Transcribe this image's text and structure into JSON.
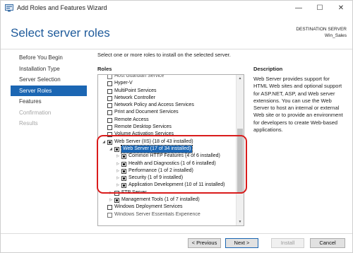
{
  "window": {
    "title": "Add Roles and Features Wizard",
    "controls": {
      "minimize": "—",
      "maximize": "☐",
      "close": "✕"
    }
  },
  "page": {
    "heading": "Select server roles",
    "destination_label": "DESTINATION SERVER",
    "destination_server": "Win_Sales",
    "intro": "Select one or more roles to install on the selected server."
  },
  "nav": {
    "items": [
      {
        "label": "Before You Begin",
        "state": "normal"
      },
      {
        "label": "Installation Type",
        "state": "normal"
      },
      {
        "label": "Server Selection",
        "state": "normal"
      },
      {
        "label": "Server Roles",
        "state": "active"
      },
      {
        "label": "Features",
        "state": "normal"
      },
      {
        "label": "Confirmation",
        "state": "disabled"
      },
      {
        "label": "Results",
        "state": "disabled"
      }
    ]
  },
  "roles": {
    "label": "Roles",
    "items": [
      {
        "label": "Host Guardian Service",
        "indent": 0,
        "expander": "",
        "check": "empty",
        "cut": true
      },
      {
        "label": "Hyper-V",
        "indent": 0,
        "expander": "",
        "check": "empty"
      },
      {
        "label": "MultiPoint Services",
        "indent": 0,
        "expander": "",
        "check": "empty"
      },
      {
        "label": "Network Controller",
        "indent": 0,
        "expander": "",
        "check": "empty"
      },
      {
        "label": "Network Policy and Access Services",
        "indent": 0,
        "expander": "",
        "check": "empty"
      },
      {
        "label": "Print and Document Services",
        "indent": 0,
        "expander": "",
        "check": "empty"
      },
      {
        "label": "Remote Access",
        "indent": 0,
        "expander": "",
        "check": "empty"
      },
      {
        "label": "Remote Desktop Services",
        "indent": 0,
        "expander": "",
        "check": "empty"
      },
      {
        "label": "Volume Activation Services",
        "indent": 0,
        "expander": "",
        "check": "empty"
      },
      {
        "label": "Web Server (IIS) (18 of 43 installed)",
        "indent": 0,
        "expander": "◢",
        "check": "filled"
      },
      {
        "label": "Web Server (17 of 34 installed)",
        "indent": 1,
        "expander": "◢",
        "check": "filled",
        "selected": true
      },
      {
        "label": "Common HTTP Features (4 of 6 installed)",
        "indent": 2,
        "expander": "▷",
        "check": "filled"
      },
      {
        "label": "Health and Diagnostics (1 of 6 installed)",
        "indent": 2,
        "expander": "▷",
        "check": "filled"
      },
      {
        "label": "Performance (1 of 2 installed)",
        "indent": 2,
        "expander": "▷",
        "check": "filled"
      },
      {
        "label": "Security (1 of 9 installed)",
        "indent": 2,
        "expander": "▷",
        "check": "filled"
      },
      {
        "label": "Application Development (10 of 11 installed)",
        "indent": 2,
        "expander": "▷",
        "check": "filled"
      },
      {
        "label": "FTP Server",
        "indent": 1,
        "expander": "▷",
        "check": "empty"
      },
      {
        "label": "Management Tools (1 of 7 installed)",
        "indent": 1,
        "expander": "▷",
        "check": "filled"
      },
      {
        "label": "Windows Deployment Services",
        "indent": 0,
        "expander": "",
        "check": "empty"
      },
      {
        "label": "Windows Server Essentials Experience",
        "indent": 0,
        "expander": "",
        "check": "empty",
        "cut": true
      }
    ],
    "scroll": {
      "up": "▲",
      "down": "▼"
    }
  },
  "description": {
    "label": "Description",
    "text": "Web Server provides support for HTML Web sites and optional support for ASP.NET, ASP, and Web server extensions. You can use the Web Server to host an internal or external Web site or to provide an environment for developers to create Web-based applications."
  },
  "footer": {
    "previous": "< Previous",
    "next": "Next >",
    "install": "Install",
    "cancel": "Cancel"
  },
  "colors": {
    "accent": "#1b66b3",
    "heading": "#1e5a9a",
    "highlight": "#d91c1c"
  }
}
